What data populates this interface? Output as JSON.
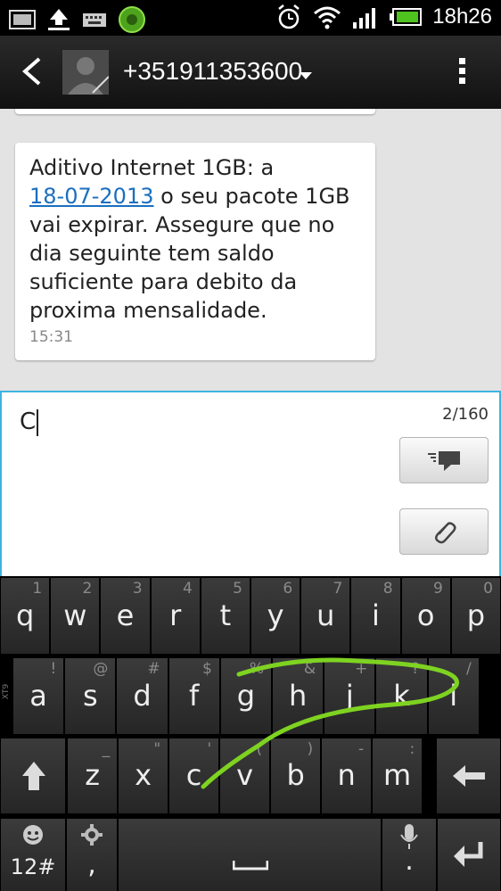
{
  "status_bar": {
    "time": "18h26",
    "icons": [
      "image-icon",
      "upload-icon",
      "keyboard-icon",
      "app-badge-icon",
      "alarm-icon",
      "wifi-icon",
      "signal-icon",
      "battery-icon"
    ]
  },
  "header": {
    "contact": "+351911353600",
    "icons": [
      "back-icon",
      "avatar",
      "chevron-down-icon",
      "overflow-menu-icon"
    ]
  },
  "thread": {
    "message": {
      "text_before": "Aditivo Internet 1GB: a",
      "link": "18-07-2013",
      "text_after": "o seu pacote 1GB vai expirar. Assegure que no dia seguinte tem saldo suficiente para debito da proxima mensalidade.",
      "time": "15:31"
    }
  },
  "compose": {
    "value": "C",
    "counter": "2/160",
    "send_icon": "send-icon",
    "attach_icon": "paperclip-icon"
  },
  "keyboard": {
    "side_label": "XT9",
    "row1": [
      {
        "k": "q",
        "h": "1"
      },
      {
        "k": "w",
        "h": "2"
      },
      {
        "k": "e",
        "h": "3"
      },
      {
        "k": "r",
        "h": "4"
      },
      {
        "k": "t",
        "h": "5"
      },
      {
        "k": "y",
        "h": "6"
      },
      {
        "k": "u",
        "h": "7"
      },
      {
        "k": "i",
        "h": "8"
      },
      {
        "k": "o",
        "h": "9"
      },
      {
        "k": "p",
        "h": "0"
      }
    ],
    "row2": [
      {
        "k": "a",
        "h": "!"
      },
      {
        "k": "s",
        "h": "@"
      },
      {
        "k": "d",
        "h": "#"
      },
      {
        "k": "f",
        "h": "$"
      },
      {
        "k": "g",
        "h": "%"
      },
      {
        "k": "h",
        "h": "&"
      },
      {
        "k": "j",
        "h": "+"
      },
      {
        "k": "k",
        "h": "?"
      },
      {
        "k": "l",
        "h": "/"
      }
    ],
    "row3": [
      {
        "k": "z",
        "h": "_"
      },
      {
        "k": "x",
        "h": "\""
      },
      {
        "k": "c",
        "h": "'"
      },
      {
        "k": "v",
        "h": "("
      },
      {
        "k": "b",
        "h": ")"
      },
      {
        "k": "n",
        "h": "-"
      },
      {
        "k": "m",
        "h": ":"
      }
    ],
    "symbols_label": "12#",
    "comma_label": ",",
    "period_label": ".",
    "swipe_color": "#7ed321"
  },
  "colors": {
    "accent": "#3fb3e0",
    "link": "#1a6fbf"
  }
}
